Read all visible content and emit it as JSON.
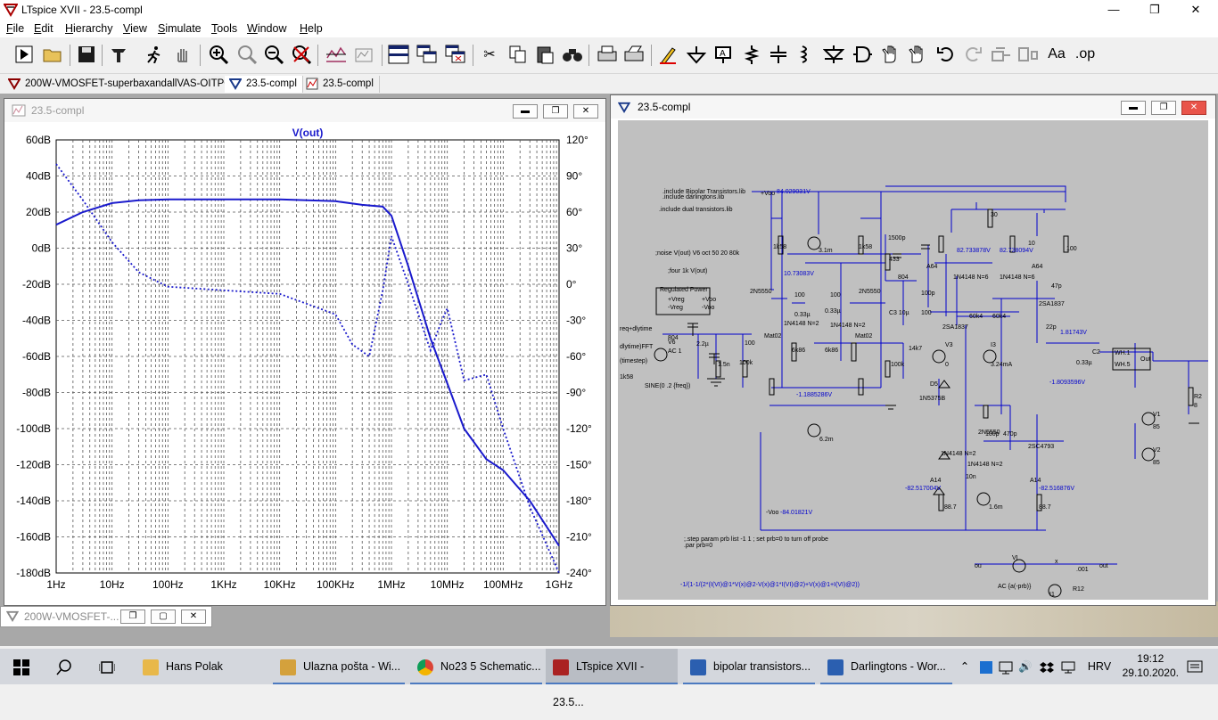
{
  "window": {
    "title": "LTspice XVII - 23.5-compl"
  },
  "menu": [
    "File",
    "Edit",
    "Hierarchy",
    "View",
    "Simulate",
    "Tools",
    "Window",
    "Help"
  ],
  "toolbar_icons": [
    "run-icon",
    "open-icon",
    "save-icon",
    "control-panel-icon",
    "run-man-icon",
    "halt-hand-icon",
    "zoom-in-icon",
    "zoom-pan-icon",
    "zoom-out-icon",
    "zoom-cancel-icon",
    "autorange-icon",
    "waveform-icon",
    "tile-icon",
    "cascade-icon",
    "close-windows-icon",
    "cut-icon",
    "copy-icon",
    "paste-icon",
    "find-icon",
    "print-icon",
    "print-setup-icon",
    "wire-icon",
    "ground-icon",
    "label-icon",
    "resistor-icon",
    "capacitor-icon",
    "inductor-icon",
    "diode-icon",
    "component-icon",
    "move-icon",
    "drag-icon",
    "undo-icon",
    "redo-icon",
    "rotate-icon",
    "mirror-icon",
    "text-icon",
    "spice-directive-icon"
  ],
  "tabs": [
    {
      "label": "200W-VMOSFET-superbaxandallVAS-OITPC",
      "icon": "schematic-icon"
    },
    {
      "label": "23.5-compl",
      "icon": "schematic-icon"
    },
    {
      "label": "23.5-compl",
      "icon": "waveform-icon"
    }
  ],
  "plot_window": {
    "title": "23.5-compl"
  },
  "schematic_window": {
    "title": "23.5-compl"
  },
  "minimized_window": {
    "title": "200W-VMOSFET-..."
  },
  "chart_data": {
    "type": "line",
    "title": "V(out)",
    "x_scale": "log",
    "x_ticks": [
      "1Hz",
      "10Hz",
      "100Hz",
      "1KHz",
      "10KHz",
      "100KHz",
      "1MHz",
      "10MHz",
      "100MHz",
      "1GHz"
    ],
    "y_left_ticks": [
      "60dB",
      "40dB",
      "20dB",
      "0dB",
      "-20dB",
      "-40dB",
      "-60dB",
      "-80dB",
      "-100dB",
      "-120dB",
      "-140dB",
      "-160dB",
      "-180dB"
    ],
    "y_right_ticks": [
      "120°",
      "90°",
      "60°",
      "30°",
      "0°",
      "-30°",
      "-60°",
      "-90°",
      "-120°",
      "-150°",
      "-180°",
      "-210°",
      "-240°"
    ],
    "ylim": [
      -180,
      60
    ],
    "y2lim": [
      -240,
      120
    ],
    "series": [
      {
        "kind": "magnitude",
        "style": "solid",
        "color": "#1a1acc",
        "unit": "dB",
        "x": [
          1,
          3,
          10,
          30,
          100,
          1000,
          10000,
          100000,
          300000,
          700000,
          1000000,
          2000000,
          5000000,
          10000000,
          20000000,
          50000000,
          100000000,
          300000000,
          1000000000
        ],
        "y": [
          13,
          20,
          25,
          26.5,
          27,
          27,
          27,
          26,
          24,
          23,
          18,
          -10,
          -50,
          -75,
          -100,
          -117,
          -123,
          -140,
          -165
        ]
      },
      {
        "kind": "phase",
        "style": "dotted",
        "color": "#1a1acc",
        "unit": "deg",
        "x": [
          1,
          3,
          10,
          30,
          100,
          1000,
          10000,
          100000,
          200000,
          400000,
          700000,
          1000000,
          2000000,
          5000000,
          8000000,
          10000000,
          20000000,
          50000000,
          100000000,
          300000000,
          1000000000
        ],
        "y": [
          100,
          70,
          35,
          10,
          -2,
          -5,
          -8,
          -25,
          -50,
          -60,
          -5,
          40,
          0,
          -55,
          -30,
          -20,
          -80,
          -75,
          -120,
          -185,
          -240
        ]
      }
    ]
  },
  "schematic": {
    "directives": [
      ".include Bipolar Transistors.lib",
      ".include darlingtons.lib",
      ".include dual transistors.lib",
      ";noise V(out) V6 oct 50 20 80k",
      ";four 1k V(out)",
      "req+dlytime",
      "dlytime)FFT",
      "(timestep)",
      "SINE(0 .2 {freq})",
      ";.step param prb list -1 1 ; set prb=0 to turn off probe",
      ".par prb=0",
      "-1/(1-1/(2*(I(VI)@1*V(x)@2-V(x)@1*I(VI)@2)+V(x)@1+I(VI)@2))"
    ],
    "voltages": [
      "84.029031V",
      "10.73083V",
      "82.733878V",
      "82.738094V",
      "1.81743V",
      "-1.1885286V",
      "-1.8093596V",
      "-82.517004V",
      "-82.516876V",
      "-84.01821V"
    ],
    "parts": [
      "1k58",
      "3.1m",
      "1k58",
      "1500p",
      "433",
      "100",
      "100",
      "30",
      "10",
      "100",
      "2N5550",
      "100",
      "100",
      "1N4148 N=2",
      "0.33µ",
      "Mat02",
      "6k86",
      "1N4148 N=2",
      "0.33µ",
      "6k86",
      "100",
      "Mat02",
      "100",
      "100",
      "804",
      "C3 10µ",
      "14k7",
      "100k",
      "100p",
      "100",
      "A64",
      "A64",
      "1N4148 N=6",
      "1N4148 N=6",
      "47p",
      "60k4",
      "60k4",
      "2SA1837",
      "2SA1837",
      "22p",
      "V3",
      "0",
      "I3",
      "3.24mA",
      "C2",
      "0.33µ",
      "WH.1",
      "WH.5",
      "Out",
      "V6",
      "AC 1",
      "804",
      "2.2µ",
      "100",
      "1.5n",
      "100k",
      "Regulated Power",
      "+Vreg",
      "-Vreg",
      "+Voo",
      "-Voo",
      "6.2m",
      "D5",
      "1N5375B",
      "2N5550",
      "100p",
      "470p",
      "2SC4793",
      "1N4148 N=2",
      "1N4148 N=2",
      "10n",
      "1.6m",
      "A14",
      "A14",
      "88.7",
      "88.7",
      "V1",
      "85",
      "V2",
      "85",
      "R2",
      "8",
      "VI",
      "x",
      "out",
      "ou",
      "R12",
      ".001",
      "AC {a(-prb)}",
      "I1",
      "+Voo",
      "-Voo",
      "Voo1",
      "Voo1"
    ]
  },
  "taskbar": {
    "items": [
      {
        "label": "Hans Polak",
        "color": "#e8b84a"
      },
      {
        "label": "Ulazna pošta - Wi...",
        "color": "#d4a13c"
      },
      {
        "label": "No23 5 Schematic...",
        "color": "#dd4433"
      },
      {
        "label": "LTspice XVII - 23.5...",
        "color": "#aa2222"
      },
      {
        "label": "bipolar transistors...",
        "color": "#2b5fb0"
      },
      {
        "label": "Darlingtons - Wor...",
        "color": "#2b5fb0"
      }
    ],
    "lang": "HRV",
    "time": "19:12",
    "date": "29.10.2020."
  }
}
